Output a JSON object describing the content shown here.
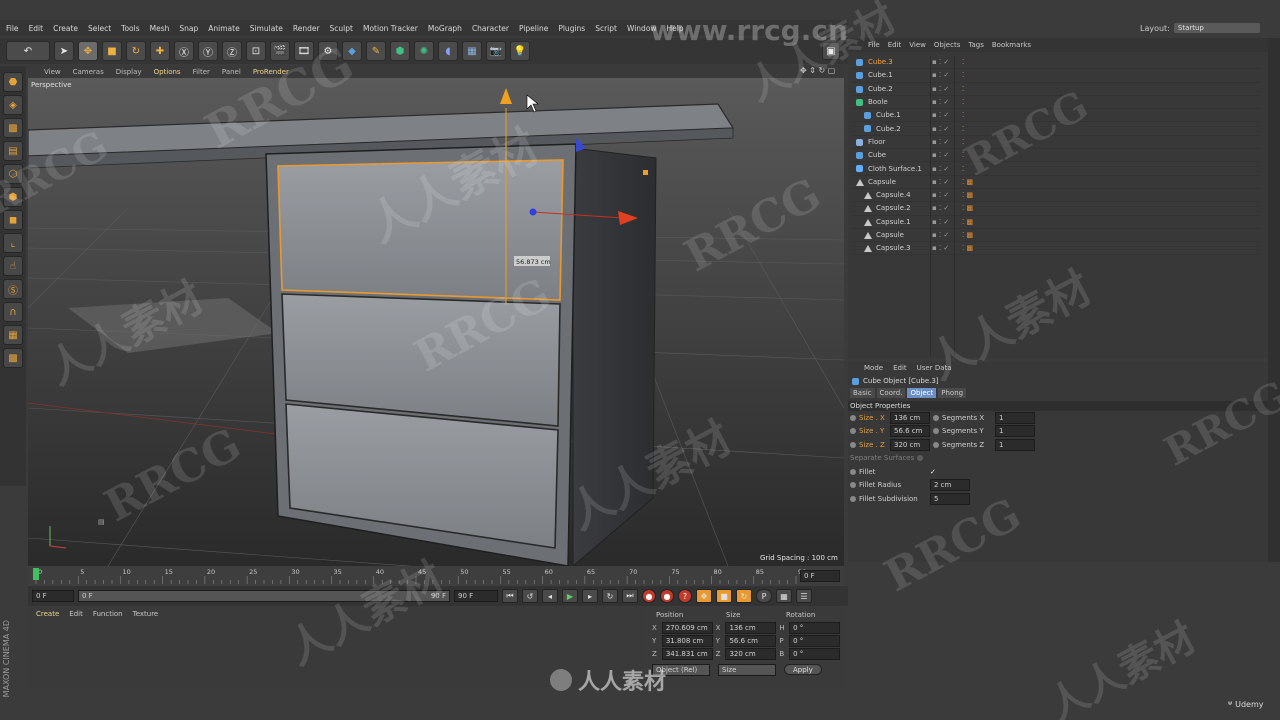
{
  "menubar": [
    "File",
    "Edit",
    "Create",
    "Select",
    "Tools",
    "Mesh",
    "Snap",
    "Animate",
    "Simulate",
    "Render",
    "Sculpt",
    "Motion Tracker",
    "MoGraph",
    "Character",
    "Pipeline",
    "Plugins",
    "Script",
    "Window",
    "Help"
  ],
  "layout": {
    "label": "Layout:",
    "value": "Startup"
  },
  "site_watermark": "www.rrcg.cn",
  "viewport": {
    "menu": [
      "View",
      "Cameras",
      "Display",
      "Options",
      "Filter",
      "Panel",
      "ProRender"
    ],
    "label": "Perspective",
    "measure": "56.873 cm",
    "grid_spacing": "Grid Spacing : 100 cm"
  },
  "timeline": {
    "ticks": [
      "0",
      "5",
      "10",
      "15",
      "20",
      "25",
      "30",
      "35",
      "40",
      "45",
      "50",
      "55",
      "60",
      "65",
      "70",
      "75",
      "80",
      "85",
      "90"
    ],
    "end_field": "0 F",
    "start": "0 F",
    "slider_start": "0 F",
    "slider_end": "90 F",
    "max": "90 F"
  },
  "material_menu": [
    "Create",
    "Edit",
    "Function",
    "Texture"
  ],
  "coords": {
    "headers": [
      "Position",
      "Size",
      "Rotation"
    ],
    "rows": [
      {
        "pa": "X",
        "pv": "270.609 cm",
        "sa": "X",
        "sv": "136 cm",
        "ra": "H",
        "rv": "0 °"
      },
      {
        "pa": "Y",
        "pv": "31.808 cm",
        "sa": "Y",
        "sv": "56.6 cm",
        "ra": "P",
        "rv": "0 °"
      },
      {
        "pa": "Z",
        "pv": "341.831 cm",
        "sa": "Z",
        "sv": "320 cm",
        "ra": "B",
        "rv": "0 °"
      }
    ],
    "mode_left": "Object (Rel)",
    "mode_right": "Size",
    "apply": "Apply"
  },
  "objects": {
    "menu": [
      "File",
      "Edit",
      "View",
      "Objects",
      "Tags",
      "Bookmarks"
    ],
    "items": [
      {
        "name": "Cube.3",
        "indent": 0,
        "type": "cube",
        "hl": true
      },
      {
        "name": "Cube.1",
        "indent": 0,
        "type": "cube",
        "hl": false
      },
      {
        "name": "Cube.2",
        "indent": 0,
        "type": "cube",
        "hl": false
      },
      {
        "name": "Boole",
        "indent": 0,
        "type": "boole",
        "hl": false
      },
      {
        "name": "Cube.1",
        "indent": 1,
        "type": "cube",
        "hl": false
      },
      {
        "name": "Cube.2",
        "indent": 1,
        "type": "cube",
        "hl": false
      },
      {
        "name": "Floor",
        "indent": 0,
        "type": "floor",
        "hl": false
      },
      {
        "name": "Cube",
        "indent": 0,
        "type": "cube",
        "hl": false
      },
      {
        "name": "Cloth Surface.1",
        "indent": 0,
        "type": "cloth",
        "hl": false
      },
      {
        "name": "Capsule",
        "indent": 0,
        "type": "capsule",
        "hl": false
      },
      {
        "name": "Capsule.4",
        "indent": 1,
        "type": "capsule",
        "hl": false
      },
      {
        "name": "Capsule.2",
        "indent": 1,
        "type": "capsule",
        "hl": false
      },
      {
        "name": "Capsule.1",
        "indent": 1,
        "type": "capsule",
        "hl": false
      },
      {
        "name": "Capsule",
        "indent": 1,
        "type": "capsule",
        "hl": false
      },
      {
        "name": "Capsule.3",
        "indent": 1,
        "type": "capsule",
        "hl": false
      }
    ]
  },
  "attributes": {
    "menu": [
      "Mode",
      "Edit",
      "User Data"
    ],
    "title": "Cube Object [Cube.3]",
    "tabs": [
      "Basic",
      "Coord.",
      "Object",
      "Phong"
    ],
    "active_tab": "Object",
    "section": "Object Properties",
    "size_rows": [
      {
        "label": "Size . X",
        "value": "136 cm",
        "seg": "Segments X",
        "segv": "1"
      },
      {
        "label": "Size . Y",
        "value": "56.6 cm",
        "seg": "Segments Y",
        "segv": "1"
      },
      {
        "label": "Size . Z",
        "value": "320 cm",
        "seg": "Segments Z",
        "segv": "1"
      }
    ],
    "separate": "Separate Surfaces",
    "fillet": "Fillet",
    "fillet_check": "✓",
    "fillet_radius": "Fillet Radius",
    "fillet_radius_v": "2 cm",
    "fillet_sub": "Fillet Subdivision",
    "fillet_sub_v": "5"
  },
  "branding": {
    "maxon": "MAXON CINEMA 4D",
    "udemy": "Udemy",
    "bottom_logo": "人人素材"
  },
  "watermarks": {
    "rrcg": "RRCG",
    "cn": "人人素材"
  }
}
